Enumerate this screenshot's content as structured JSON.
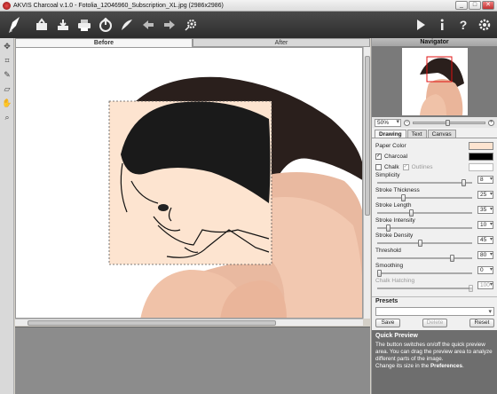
{
  "window": {
    "title": "AKVIS Charcoal v.1.0 - Fotolia_12046960_Subscription_XL.jpg (2986x2986)",
    "minimize": "_",
    "maximize": "□",
    "close": "✕"
  },
  "toolbar": {
    "icons": [
      "logo-brush-icon",
      "open-icon",
      "save-icon",
      "print-icon",
      "share-icon",
      "export-icon",
      "undo-icon",
      "redo-icon",
      "settings-gear-icon",
      "run-icon",
      "info-icon",
      "help-icon",
      "preferences-icon"
    ]
  },
  "left_tools": [
    "hand-icon",
    "crop-icon",
    "brush-icon",
    "eraser-icon",
    "hand-pan-icon",
    "zoom-icon"
  ],
  "view_tabs": {
    "before": "Before",
    "after": "After"
  },
  "navigator": {
    "header": "Navigator",
    "zoom": "50%"
  },
  "param_tabs": {
    "drawing": "Drawing",
    "text": "Text",
    "canvas": "Canvas"
  },
  "drawing": {
    "paper_color_label": "Paper Color",
    "charcoal_label": "Charcoal",
    "charcoal_checked": "✓",
    "chalk_label": "Chalk",
    "outlines_label": "Outlines",
    "outlines_checked": "✓",
    "paper_color": "#fde4d0",
    "charcoal_color": "#000000",
    "chalk_color": "#ffffff"
  },
  "sliders": [
    {
      "label": "Simplicity",
      "value": "8",
      "fraction": 0.92
    },
    {
      "label": "Stroke Thickness",
      "value": "25",
      "fraction": 0.26
    },
    {
      "label": "Stroke Length",
      "value": "35",
      "fraction": 0.35
    },
    {
      "label": "Stroke Intensity",
      "value": "10",
      "fraction": 0.1
    },
    {
      "label": "Stroke Density",
      "value": "45",
      "fraction": 0.45
    },
    {
      "label": "Threshold",
      "value": "80",
      "fraction": 0.8
    },
    {
      "label": "Smoothing",
      "value": "0",
      "fraction": 0.0
    },
    {
      "label": "Chalk Hatching",
      "value": "100",
      "fraction": 1.0,
      "disabled": true
    }
  ],
  "presets": {
    "header": "Presets",
    "save": "Save",
    "delete": "Delete",
    "reset": "Reset"
  },
  "quick_preview": {
    "title": "Quick Preview",
    "text1": "The button switches on/off the quick preview area. You can drag the preview area to analyze different parts of the image.",
    "text2": "Change its size in the ",
    "text2_bold": "Preferences",
    "text2_end": "."
  }
}
